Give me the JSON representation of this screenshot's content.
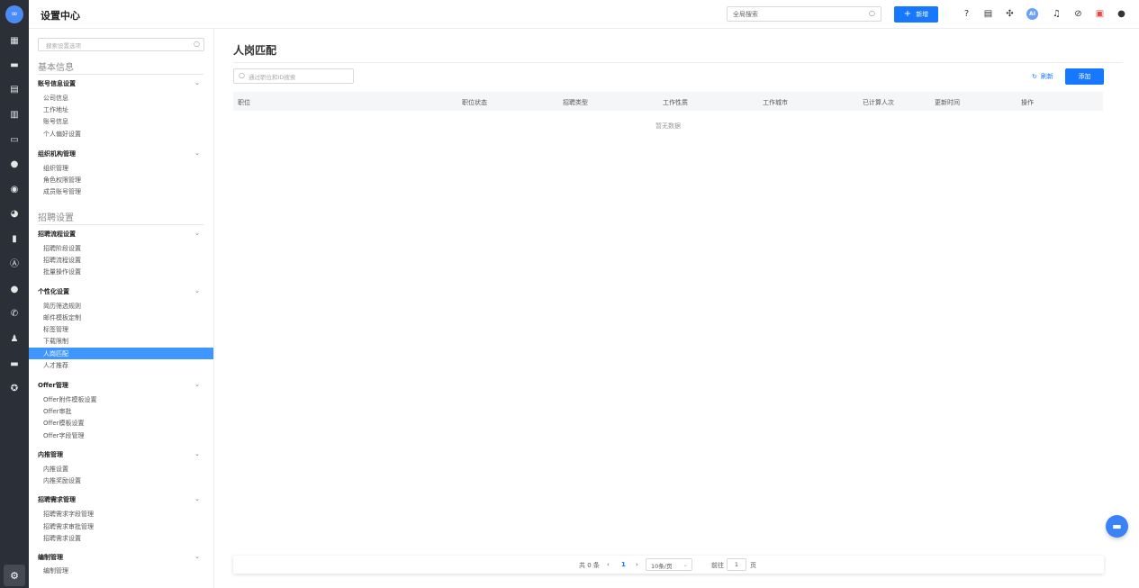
{
  "header": {
    "title": "设置中心",
    "search_placeholder": "全局搜索",
    "new_label": "新增",
    "ai_label": "AI"
  },
  "sidebar": {
    "search_placeholder": "搜索设置选项",
    "sections": [
      {
        "title": "基本信息",
        "groups": [
          {
            "title": "账号信息设置",
            "items": [
              "公司信息",
              "工作地址",
              "账号信息",
              "个人偏好设置"
            ]
          },
          {
            "title": "组织机构管理",
            "items": [
              "组织管理",
              "角色权限管理",
              "成员账号管理"
            ]
          }
        ]
      },
      {
        "title": "招聘设置",
        "groups": [
          {
            "title": "招聘流程设置",
            "items": [
              "招聘阶段设置",
              "招聘流程设置",
              "批量操作设置"
            ]
          },
          {
            "title": "个性化设置",
            "items": [
              "简历筛选规则",
              "邮件模板定制",
              "标签管理",
              "下载限制",
              "人岗匹配",
              "人才推荐"
            ]
          },
          {
            "title": "Offer管理",
            "items": [
              "Offer附件模板设置",
              "Offer审批",
              "Offer模板设置",
              "Offer字段管理"
            ]
          },
          {
            "title": "内推管理",
            "items": [
              "内推设置",
              "内推奖励设置"
            ]
          },
          {
            "title": "招聘需求管理",
            "items": [
              "招聘需求字段管理",
              "招聘需求审批管理",
              "招聘需求设置"
            ]
          },
          {
            "title": "编制管理",
            "items": [
              "编制管理"
            ]
          }
        ]
      }
    ],
    "active_item": "人岗匹配"
  },
  "main": {
    "title": "人岗匹配",
    "search_placeholder": "通过职位和ID搜索",
    "refresh_label": "刷新",
    "add_label": "添加",
    "columns": [
      "职位",
      "职位状态",
      "招聘类型",
      "工作性质",
      "工作城市",
      "已计算人次",
      "更新时间",
      "操作"
    ],
    "empty_text": "暂无数据"
  },
  "pagination": {
    "total_text": "共 0 条",
    "current_page": "1",
    "page_size": "10条/页",
    "goto_label": "前往",
    "goto_value": "1",
    "page_unit": "页"
  }
}
